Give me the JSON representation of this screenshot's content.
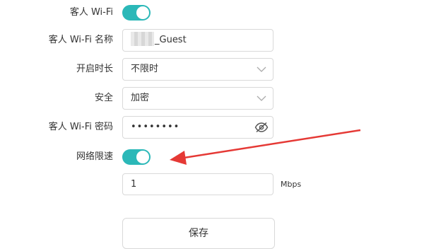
{
  "form": {
    "guest_wifi": {
      "label": "客人 Wi-Fi",
      "enabled": true
    },
    "guest_wifi_name": {
      "label": "客人 Wi-Fi 名称",
      "value": "_Guest"
    },
    "open_duration": {
      "label": "开启时长",
      "value": "不限时"
    },
    "security": {
      "label": "安全",
      "value": "加密"
    },
    "guest_wifi_password": {
      "label": "客人 Wi-Fi 密码",
      "value": "••••••••"
    },
    "network_speed_limit": {
      "label": "网络限速",
      "enabled": true
    },
    "speed_limit_value": {
      "value": "1",
      "unit": "Mbps"
    },
    "save_button": {
      "label": "保存"
    }
  },
  "colors": {
    "toggle_on": "#2bb8b8",
    "annotation_arrow": "#e53935",
    "border": "#d9d9d9"
  },
  "icons": {
    "select_chevron": "chevron-down-icon",
    "password_visibility": "eye-slash-icon"
  }
}
